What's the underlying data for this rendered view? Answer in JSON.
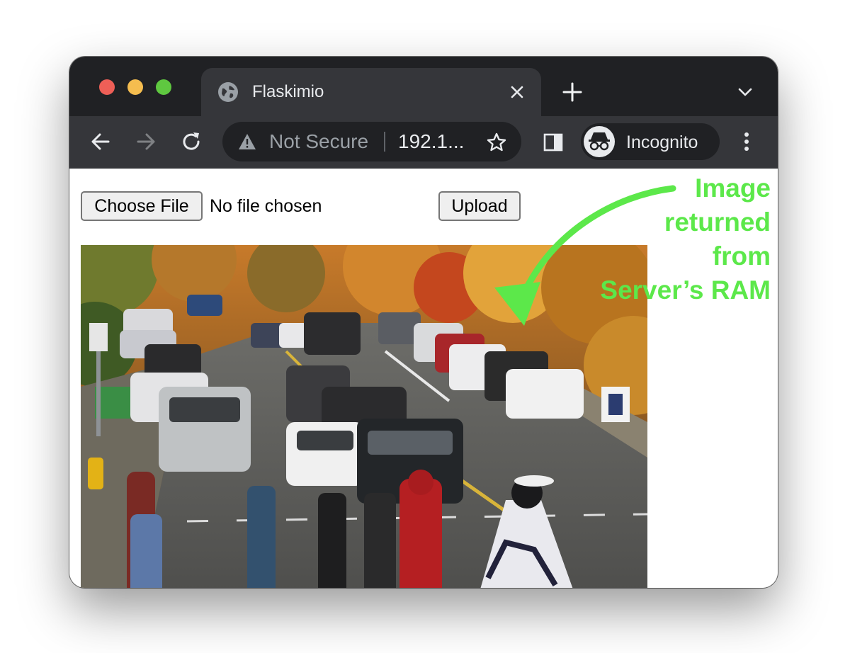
{
  "browser": {
    "tab": {
      "title": "Flaskimio",
      "favicon": "globe-icon"
    },
    "toolbar": {
      "security_label": "Not Secure",
      "url": "192.1...",
      "profile_label": "Incognito"
    },
    "colors": {
      "chrome": "#202124",
      "toolbar": "#35363a",
      "text": "#e8eaed"
    }
  },
  "page": {
    "choose_file_label": "Choose File",
    "file_status": "No file chosen",
    "upload_label": "Upload"
  },
  "annotation": {
    "lines": [
      "Image",
      "returned",
      "from",
      "Server’s RAM"
    ],
    "color": "#5ce84a"
  }
}
